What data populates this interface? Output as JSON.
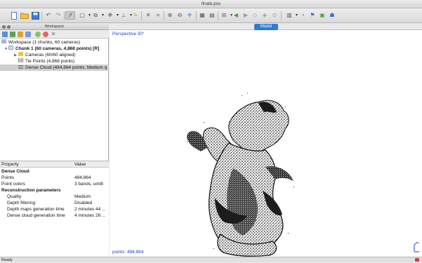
{
  "window": {
    "title": "finale.psx"
  },
  "workspace_panel": {
    "title": "Workspace",
    "tree": [
      {
        "label": "Workspace (1 chunks, 60 cameras)"
      },
      {
        "label": "Chunk 1 (60 cameras, 4,868 points) [R]"
      },
      {
        "label": "Cameras (60/60 aligned)"
      },
      {
        "label": "Tie Points (4,868 points)"
      },
      {
        "label": "Dense Cloud (484,864 points, Medium q"
      }
    ]
  },
  "properties": {
    "headers": {
      "property": "Property",
      "value": "Value"
    },
    "rows": [
      {
        "key": "Dense Cloud",
        "value": ""
      },
      {
        "key": "Points",
        "value": "484,864"
      },
      {
        "key": "Point colors",
        "value": "3 bands, uint8"
      },
      {
        "key": "Reconstruction parameters",
        "value": ""
      },
      {
        "key": "Quality",
        "value": "Medium"
      },
      {
        "key": "Depth filtering",
        "value": "Disabled"
      },
      {
        "key": "Depth maps generation time",
        "value": "2 minutes 44 ..."
      },
      {
        "key": "Dense cloud generation time",
        "value": "4 minutes 26 ..."
      }
    ]
  },
  "viewport": {
    "tab_label": "Model",
    "projection_label": "Perspective 30°",
    "point_count_label": "points: 484,864"
  },
  "status": {
    "text": "Ready"
  },
  "colors": {
    "accent": "#2e7bd8",
    "overlay_text": "#1d3fc8"
  }
}
